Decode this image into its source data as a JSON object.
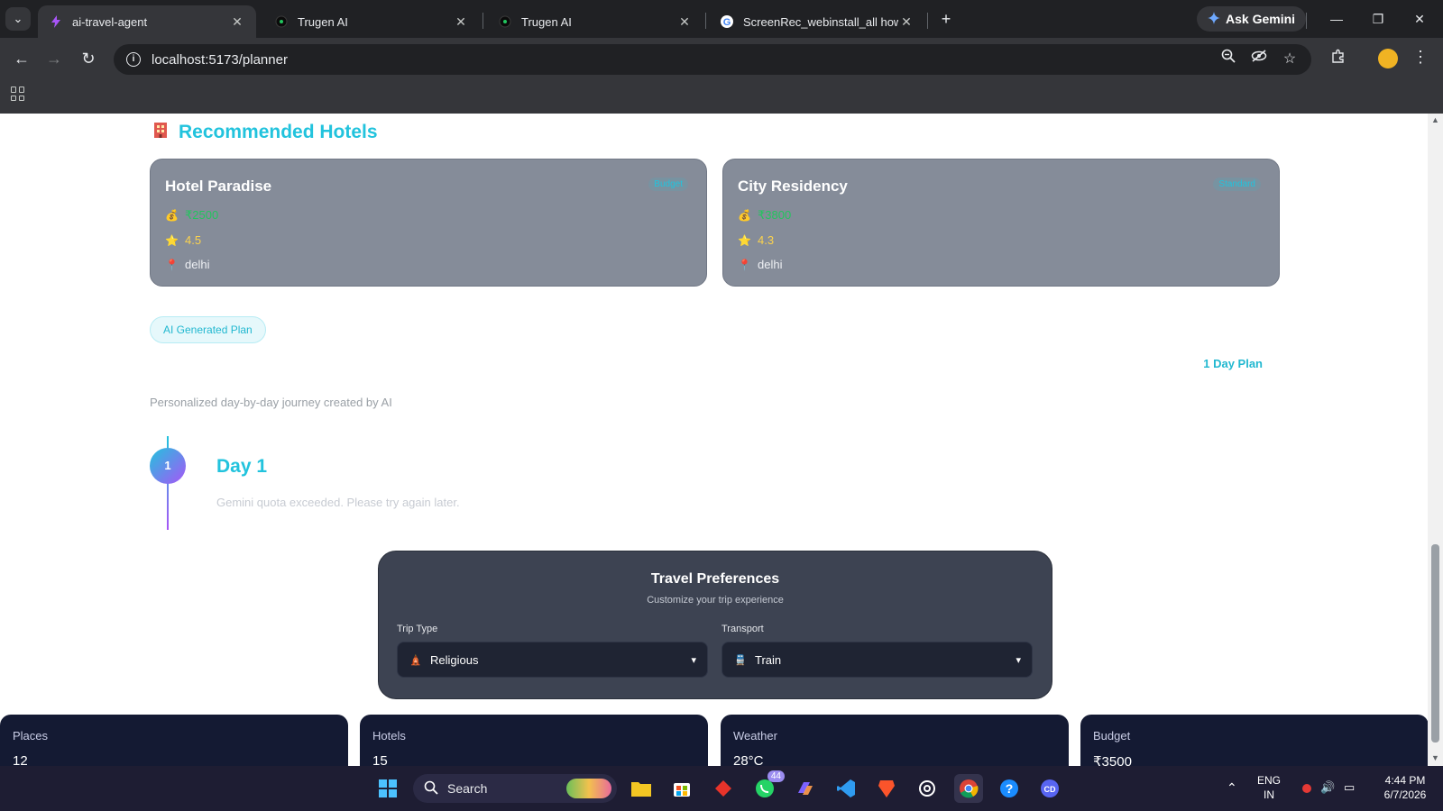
{
  "browser": {
    "tabs": [
      {
        "title": "ai-travel-agent",
        "icon": "lightning-icon",
        "active": true
      },
      {
        "title": "Trugen AI",
        "icon": "trugen-icon",
        "active": false
      },
      {
        "title": "Trugen AI",
        "icon": "trugen-icon",
        "active": false
      },
      {
        "title": "ScreenRec_webinstall_all how to",
        "icon": "google-icon",
        "active": false
      }
    ],
    "ask_gemini_label": "Ask Gemini",
    "url": "localhost:5173/planner"
  },
  "hotels": {
    "title": "Recommended Hotels",
    "items": [
      {
        "name": "Hotel Paradise",
        "tier": "Budget",
        "price": "₹2500",
        "rating": "4.5",
        "location": "delhi"
      },
      {
        "name": "City Residency",
        "tier": "Standard",
        "price": "₹3800",
        "rating": "4.3",
        "location": "delhi"
      }
    ]
  },
  "plan": {
    "badge": "AI Generated Plan",
    "count_label": "1 Day Plan",
    "subtitle": "Personalized day-by-day journey created by AI",
    "days": [
      {
        "number": "1",
        "title": "Day 1",
        "text": "Gemini quota exceeded. Please try again later."
      }
    ]
  },
  "preferences": {
    "title": "Travel Preferences",
    "subtitle": "Customize your trip experience",
    "trip_type": {
      "label": "Trip Type",
      "value": "Religious",
      "icon": "temple-icon"
    },
    "transport": {
      "label": "Transport",
      "value": "Train",
      "icon": "train-icon"
    }
  },
  "stats": [
    {
      "label": "Places",
      "value": "12"
    },
    {
      "label": "Hotels",
      "value": "15"
    },
    {
      "label": "Weather",
      "value": "28°C"
    },
    {
      "label": "Budget",
      "value": "₹3500"
    }
  ],
  "taskbar": {
    "search_label": "Search",
    "whatsapp_badge": "44",
    "lang_line1": "ENG",
    "lang_line2": "IN",
    "time": "4:44 PM",
    "date": "6/7/2026"
  },
  "colors": {
    "accent": "#22c3dd",
    "card_bg": "#858c99",
    "stat_bg": "#141a33",
    "prefs_bg": "#3d4352"
  }
}
